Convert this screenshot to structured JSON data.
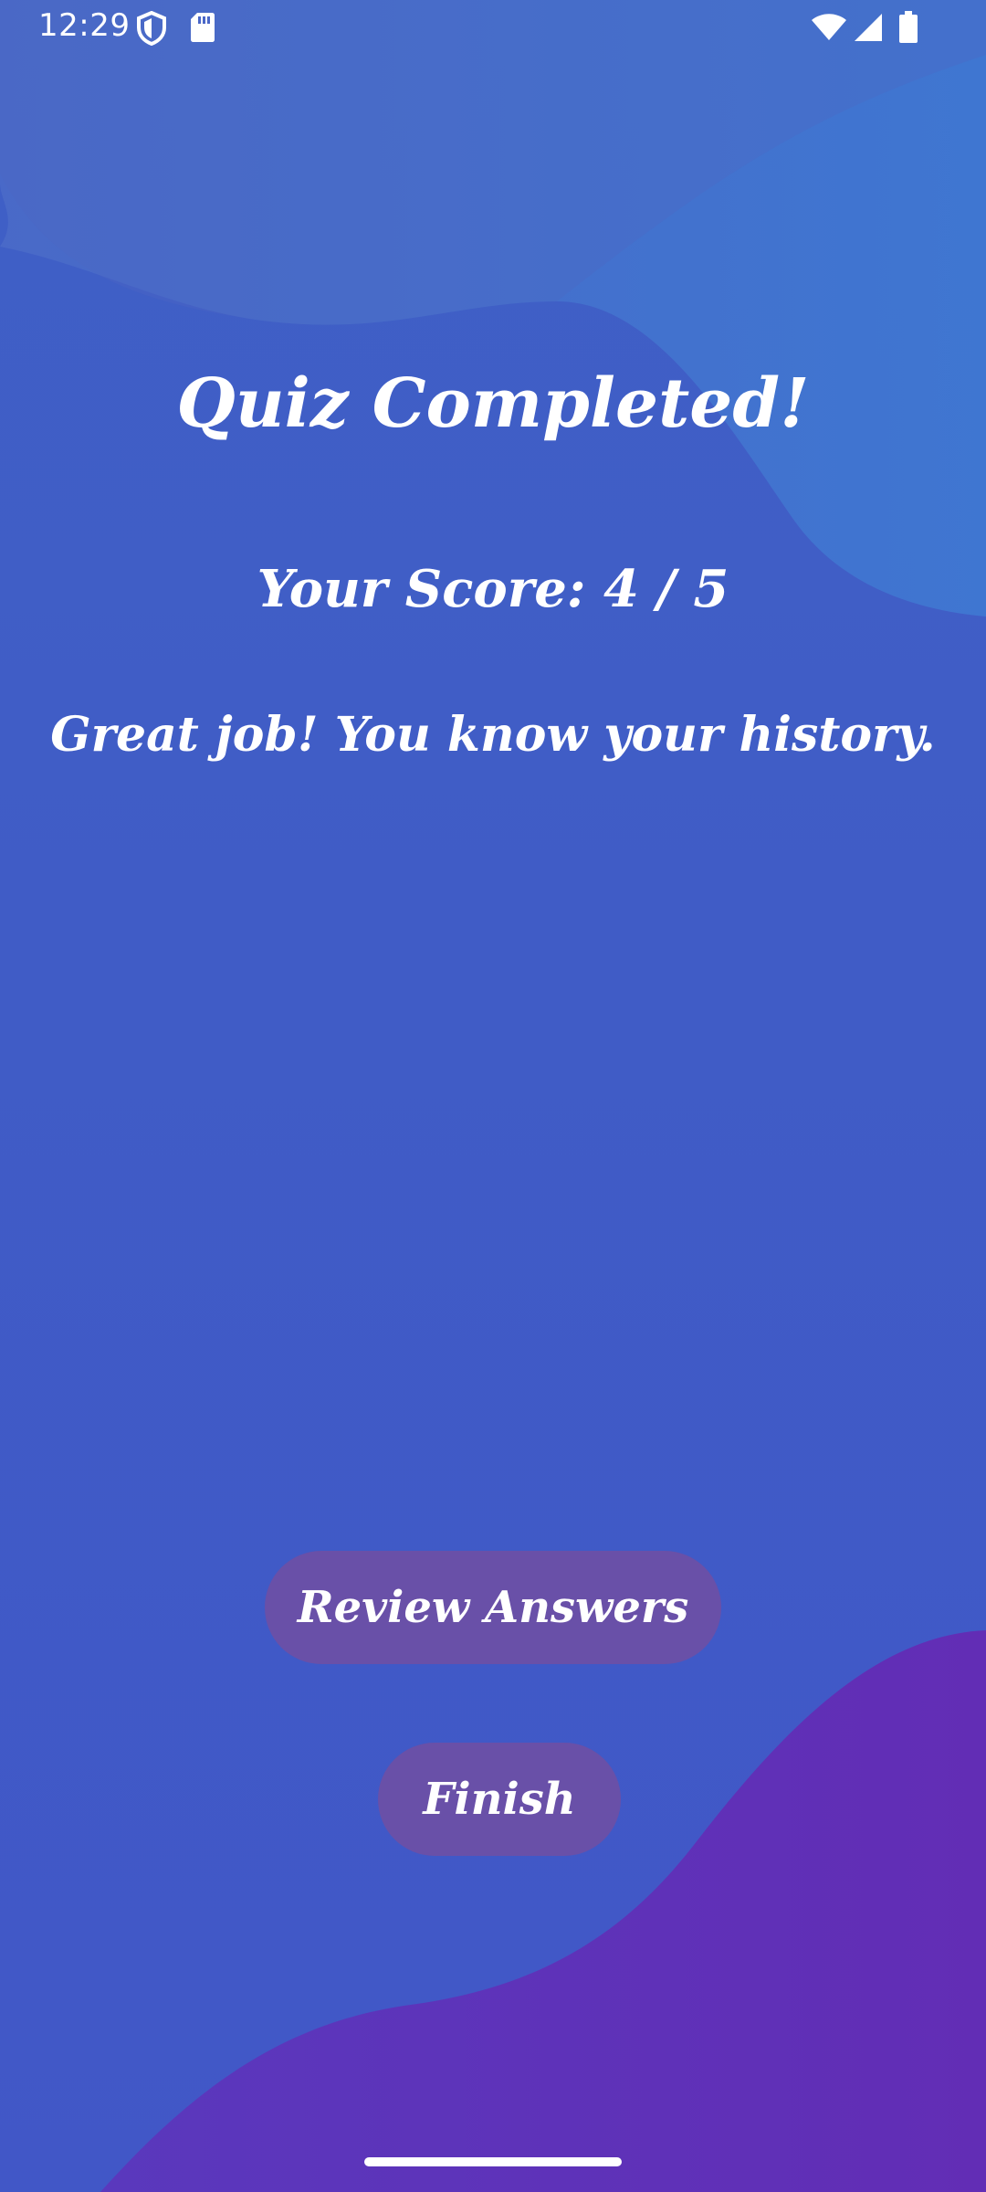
{
  "status_bar": {
    "time": "12:29",
    "icons": [
      "shield-icon",
      "sd-card-icon",
      "wifi-icon",
      "signal-icon",
      "battery-icon"
    ]
  },
  "quiz_result": {
    "title": "Quiz Completed!",
    "score_text": "Your Score: 4 / 5",
    "message": "Great job! You know your history."
  },
  "actions": {
    "review_label": "Review Answers",
    "finish_label": "Finish"
  },
  "colors": {
    "background": "#3f5fc5",
    "top_wave": "#4a79cf",
    "bottom_wave": "#5f2fb3",
    "button": "#6950a8",
    "text": "#ffffff"
  }
}
